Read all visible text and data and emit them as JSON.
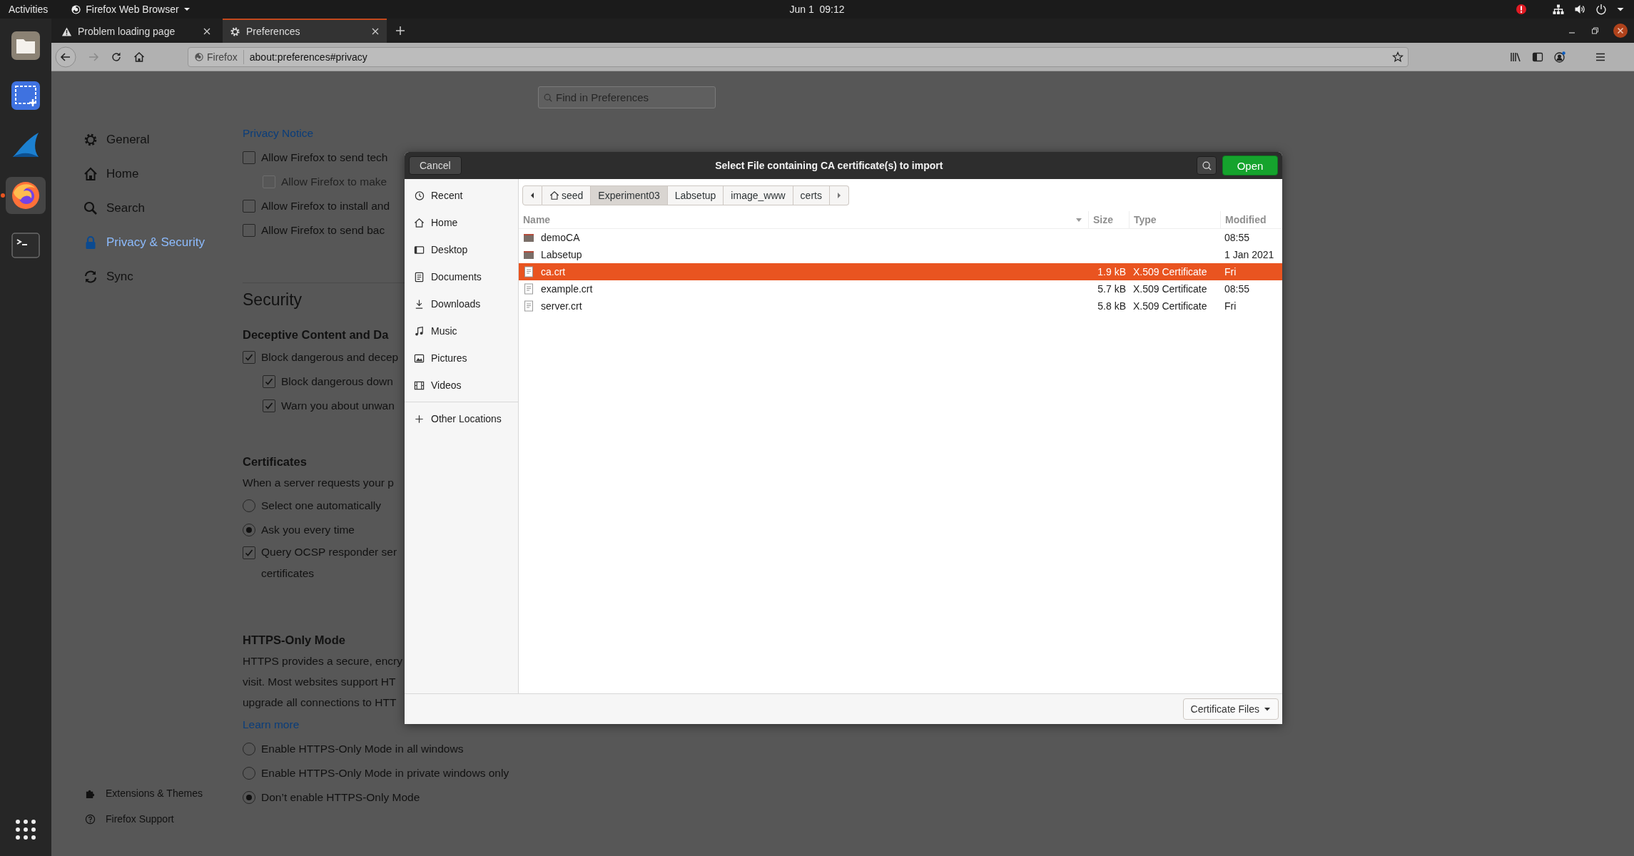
{
  "top_bar": {
    "activities": "Activities",
    "app_menu": "Firefox Web Browser",
    "clock": "Jun 1  09:12"
  },
  "dock": [
    {
      "kind": "files",
      "selected": false
    },
    {
      "kind": "screenshot",
      "selected": false
    },
    {
      "kind": "shark",
      "selected": false
    },
    {
      "kind": "firefox",
      "selected": true
    },
    {
      "kind": "terminal",
      "selected": false
    }
  ],
  "tabs": [
    {
      "title": "Problem loading page",
      "kind": "warning",
      "selected": false
    },
    {
      "title": "Preferences",
      "kind": "settings",
      "selected": true
    }
  ],
  "url_bar": {
    "identity": "Firefox",
    "url": "about:preferences#privacy"
  },
  "search": {
    "placeholder": "Find in Preferences"
  },
  "pref_nav": [
    {
      "label": "General",
      "kind": "settings",
      "selected": false
    },
    {
      "label": "Home",
      "kind": "home",
      "selected": false
    },
    {
      "label": "Search",
      "kind": "search",
      "selected": false
    },
    {
      "label": "Privacy & Security",
      "kind": "lock",
      "selected": true
    },
    {
      "label": "Sync",
      "kind": "sync",
      "selected": false
    }
  ],
  "pref_footer": [
    {
      "label": "Extensions & Themes",
      "kind": "puzzle"
    },
    {
      "label": "Firefox Support",
      "kind": "help"
    }
  ],
  "content": [
    {
      "kind": "link",
      "text": "Privacy Notice"
    },
    {
      "kind": "checkbox",
      "label": "Allow Firefox to send tech",
      "checked": false,
      "disabled": false,
      "children": [
        {
          "kind": "checkbox",
          "label": "Allow Firefox to make",
          "checked": false,
          "disabled": true
        }
      ]
    },
    {
      "kind": "checkbox",
      "label": "Allow Firefox to install and",
      "checked": false,
      "disabled": false
    },
    {
      "kind": "checkbox",
      "label": "Allow Firefox to send bac",
      "checked": false,
      "disabled": false
    },
    {
      "kind": "section_title",
      "text": "Security"
    },
    {
      "kind": "group_title",
      "text": "Deceptive Content and Da"
    },
    {
      "kind": "checkbox",
      "label": "Block dangerous and decep",
      "checked": true,
      "disabled": false,
      "children": [
        {
          "kind": "checkbox",
          "label": "Block dangerous down",
          "checked": true,
          "disabled": false
        },
        {
          "kind": "checkbox",
          "label": "Warn you about unwan",
          "checked": true,
          "disabled": false
        }
      ]
    },
    {
      "kind": "group_title",
      "text": "Certificates"
    },
    {
      "kind": "text",
      "text": "When a server requests your p"
    },
    {
      "kind": "radio",
      "label": "Select one automatically",
      "selected": false
    },
    {
      "kind": "radio",
      "label": "Ask you every time",
      "selected": true
    },
    {
      "kind": "checkbox",
      "label": "Query OCSP responder ser",
      "continuation": "certificates",
      "checked": true,
      "disabled": false
    },
    {
      "kind": "group_title",
      "text": "HTTPS-Only Mode"
    },
    {
      "kind": "paragraph",
      "lines": [
        "HTTPS provides a secure, encry",
        "visit. Most websites support HT",
        "upgrade all connections to HTT"
      ]
    },
    {
      "kind": "link",
      "text": "Learn more"
    },
    {
      "kind": "radio",
      "label": "Enable HTTPS-Only Mode in all windows",
      "selected": false
    },
    {
      "kind": "radio",
      "label": "Enable HTTPS-Only Mode in private windows only",
      "selected": false
    },
    {
      "kind": "radio",
      "label": "Don’t enable HTTPS-Only Mode",
      "selected": true
    }
  ],
  "dialog": {
    "cancel": "Cancel",
    "title": "Select File containing CA certificate(s) to import",
    "open": "Open",
    "places": [
      {
        "label": "Recent",
        "kind": "recent"
      },
      {
        "label": "Home",
        "kind": "home"
      },
      {
        "label": "Desktop",
        "kind": "desktop"
      },
      {
        "label": "Documents",
        "kind": "documents"
      },
      {
        "label": "Downloads",
        "kind": "downloads"
      },
      {
        "label": "Music",
        "kind": "music"
      },
      {
        "label": "Pictures",
        "kind": "pictures"
      },
      {
        "label": "Videos",
        "kind": "videos"
      },
      {
        "label": "Other Locations",
        "kind": "other"
      }
    ],
    "path": [
      {
        "label": "seed",
        "kind": "home",
        "selected": false
      },
      {
        "label": "Experiment03",
        "kind": "folder",
        "selected": true
      },
      {
        "label": "Labsetup",
        "kind": "folder",
        "selected": false
      },
      {
        "label": "image_www",
        "kind": "folder",
        "selected": false
      },
      {
        "label": "certs",
        "kind": "folder",
        "selected": false
      }
    ],
    "columns": [
      {
        "label": "Name",
        "sorted": true
      },
      {
        "label": "Size",
        "sorted": false
      },
      {
        "label": "Type",
        "sorted": false
      },
      {
        "label": "Modified",
        "sorted": false
      }
    ],
    "files": [
      {
        "name": "demoCA",
        "kind": "folder",
        "modified": "08:55",
        "selected": false
      },
      {
        "name": "Labsetup",
        "kind": "folder",
        "modified": "1 Jan 2021",
        "selected": false
      },
      {
        "name": "ca.crt",
        "kind": "file",
        "size": "1.9 kB",
        "type": "X.509 Certificate",
        "modified": "Fri",
        "selected": true
      },
      {
        "name": "example.crt",
        "kind": "file",
        "size": "5.7 kB",
        "type": "X.509 Certificate",
        "modified": "08:55",
        "selected": false
      },
      {
        "name": "server.crt",
        "kind": "file",
        "size": "5.8 kB",
        "type": "X.509 Certificate",
        "modified": "Fri",
        "selected": false
      }
    ],
    "filter": "Certificate Files"
  }
}
